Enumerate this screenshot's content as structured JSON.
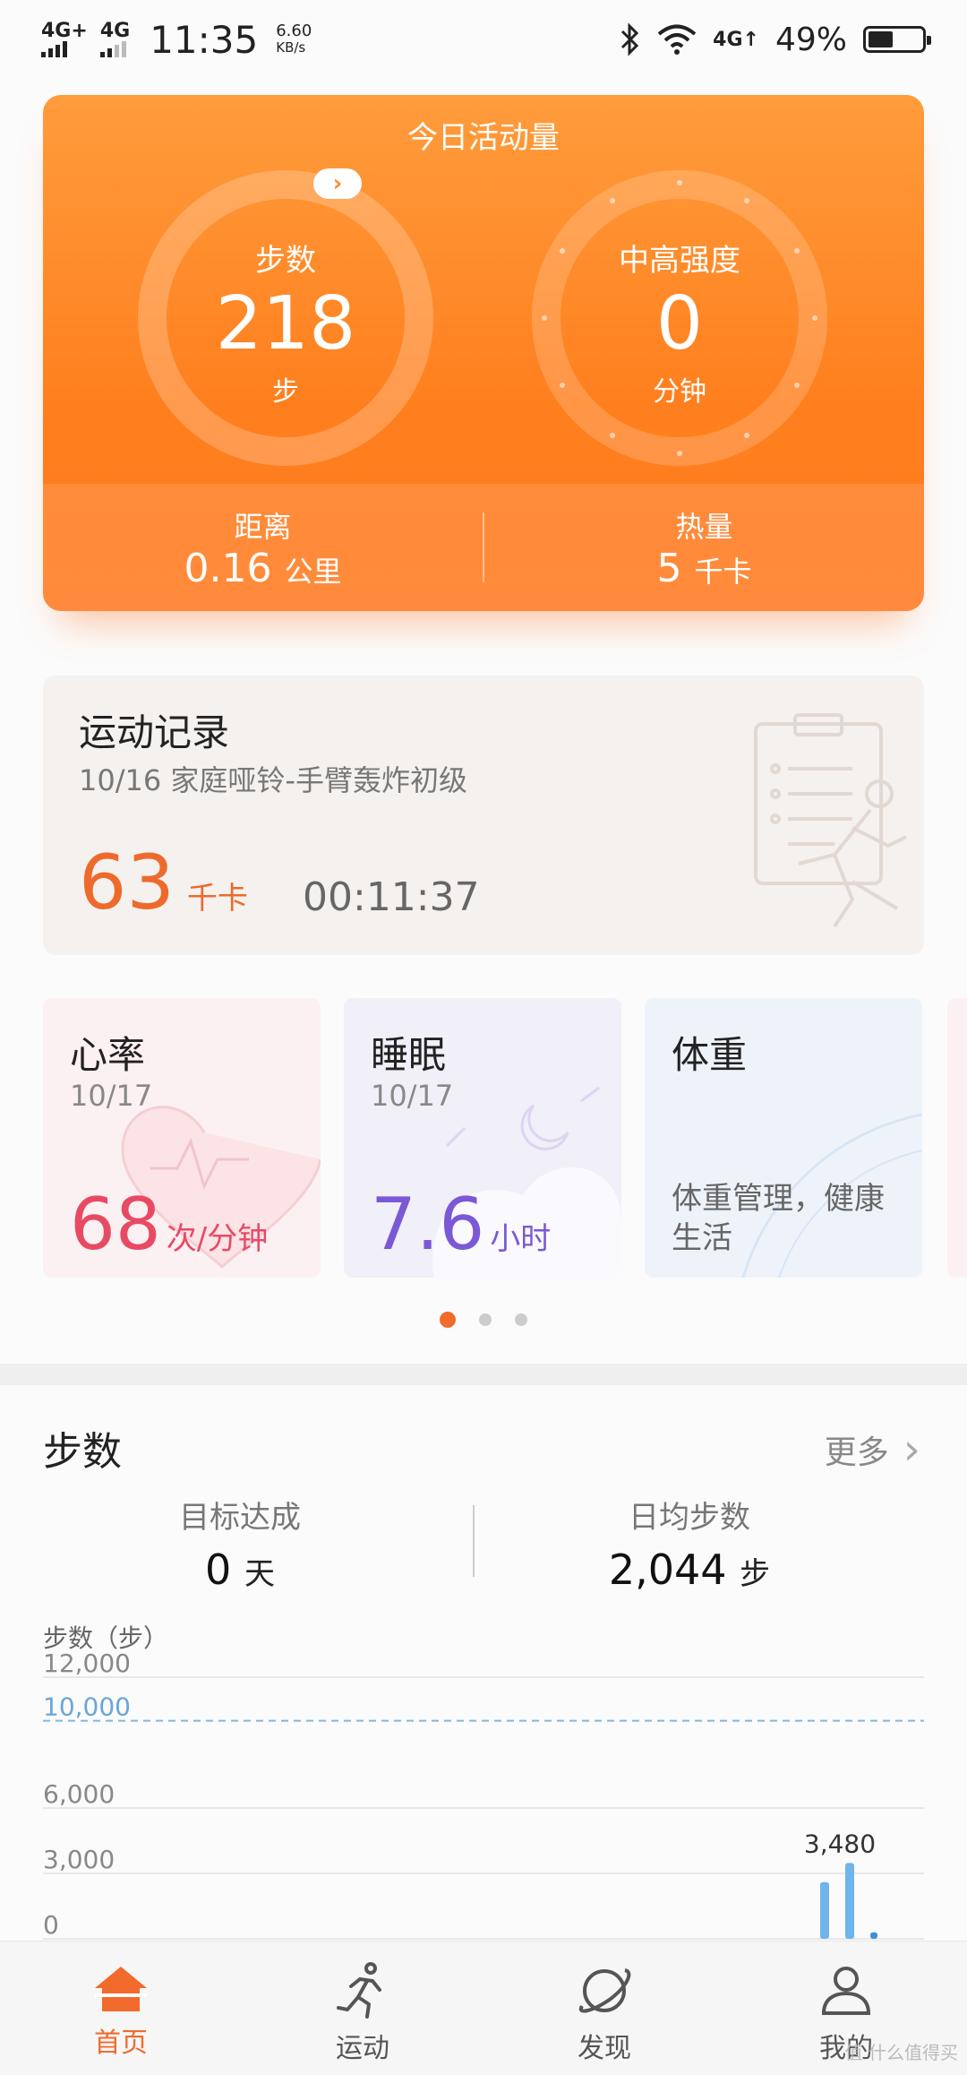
{
  "status": {
    "net1": "4G+",
    "net2": "4G",
    "time": "11:35",
    "speed_value": "6.60",
    "speed_unit": "KB/s",
    "net3": "4G↑",
    "battery": "49%"
  },
  "activity": {
    "title": "今日活动量",
    "steps_label": "步数",
    "steps_value": "218",
    "steps_unit": "步",
    "intensity_label": "中高强度",
    "intensity_value": "0",
    "intensity_unit": "分钟",
    "distance_label": "距离",
    "distance_value": "0.16",
    "distance_unit": "公里",
    "calories_label": "热量",
    "calories_value": "5",
    "calories_unit": "千卡",
    "expand_glyph": "›"
  },
  "record": {
    "title": "运动记录",
    "subtitle": "10/16  家庭哑铃-手臂轰炸初级",
    "kcal": "63",
    "kcal_unit": "千卡",
    "duration": "00:11:37"
  },
  "health": {
    "heart": {
      "title": "心率",
      "date": "10/17",
      "value": "68",
      "unit": "次/分钟"
    },
    "sleep": {
      "title": "睡眠",
      "date": "10/17",
      "value": "7.6",
      "unit": "小时"
    },
    "weight": {
      "title": "体重",
      "desc": "体重管理，健康生活"
    }
  },
  "steps": {
    "title": "步数",
    "more": "更多",
    "goal_label": "目标达成",
    "goal_value": "0",
    "goal_unit": "天",
    "avg_label": "日均步数",
    "avg_value": "2,044",
    "avg_unit": "步"
  },
  "chart_data": {
    "type": "bar",
    "ylabel": "步数（步）",
    "yticks": [
      "0",
      "3,000",
      "6,000",
      "10,000",
      "12,000"
    ],
    "ylim": [
      0,
      12000
    ],
    "target_line": 10000,
    "target_label": "10,000",
    "values": [
      2600,
      3480,
      300
    ],
    "peak_label": "3,480",
    "grid": true
  },
  "nav": {
    "items": [
      {
        "label": "首页",
        "active": true
      },
      {
        "label": "运动",
        "active": false
      },
      {
        "label": "发现",
        "active": false
      },
      {
        "label": "我的",
        "active": false
      }
    ]
  },
  "watermark": "值 什么值得买",
  "colors": {
    "accent": "#f26a2c",
    "heart": "#e84a64",
    "sleep": "#7b58d6",
    "bar": "#6fb4ec"
  }
}
